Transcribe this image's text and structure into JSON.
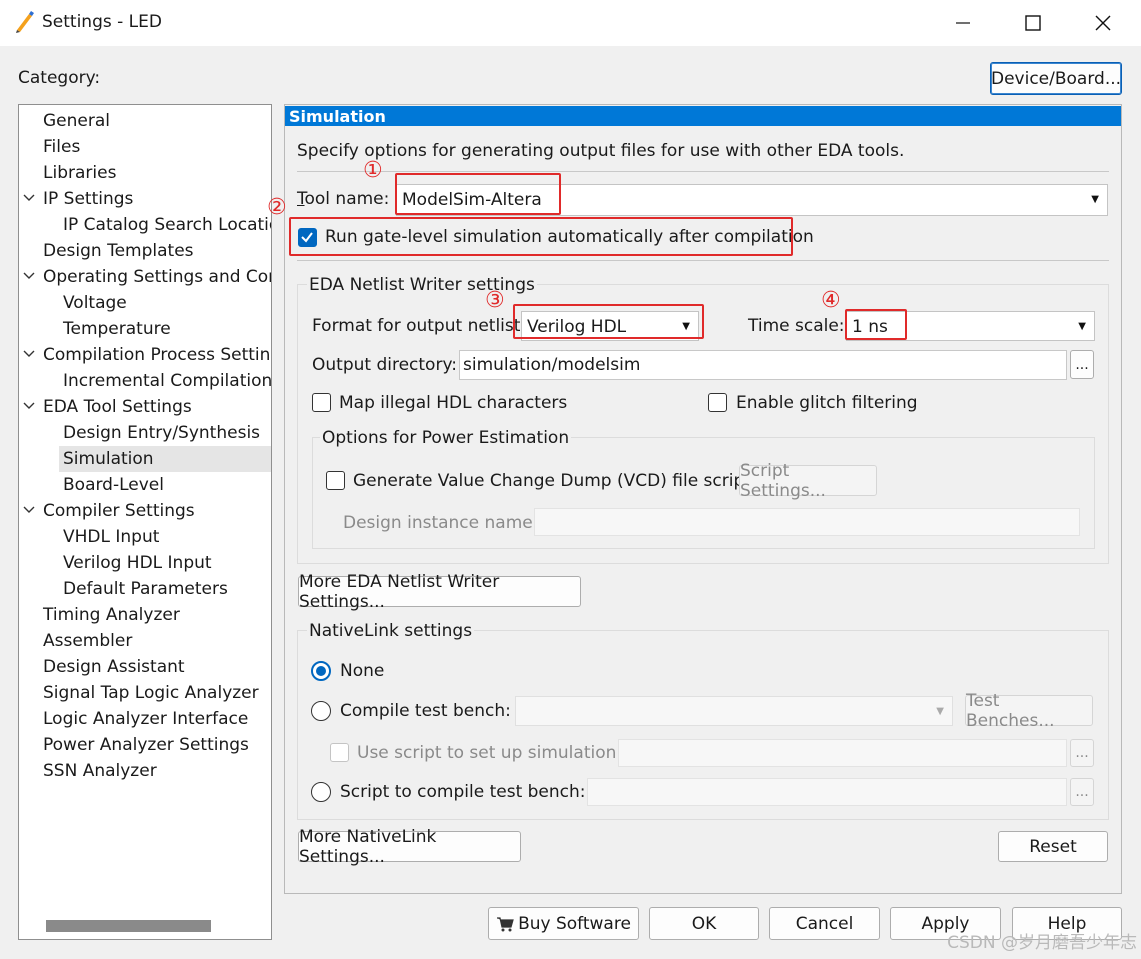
{
  "window": {
    "title": "Settings - LED",
    "icon": "quartus-pen-icon",
    "controls": [
      "minimize-icon",
      "maximize-icon",
      "close-icon"
    ]
  },
  "category_label": "Category:",
  "device_board_button": "Device/Board...",
  "tree": {
    "items": [
      {
        "label": "General",
        "level": 0
      },
      {
        "label": "Files",
        "level": 0
      },
      {
        "label": "Libraries",
        "level": 0
      },
      {
        "label": "IP Settings",
        "level": 0,
        "expanded": true
      },
      {
        "label": "IP Catalog Search Locatio",
        "level": 1
      },
      {
        "label": "Design Templates",
        "level": 0
      },
      {
        "label": "Operating Settings and Conc",
        "level": 0,
        "expanded": true
      },
      {
        "label": "Voltage",
        "level": 1
      },
      {
        "label": "Temperature",
        "level": 1
      },
      {
        "label": "Compilation Process Setting",
        "level": 0,
        "expanded": true
      },
      {
        "label": "Incremental Compilation",
        "level": 1
      },
      {
        "label": "EDA Tool Settings",
        "level": 0,
        "expanded": true
      },
      {
        "label": "Design Entry/Synthesis",
        "level": 1
      },
      {
        "label": "Simulation",
        "level": 1,
        "selected": true
      },
      {
        "label": "Board-Level",
        "level": 1
      },
      {
        "label": "Compiler Settings",
        "level": 0,
        "expanded": true
      },
      {
        "label": "VHDL Input",
        "level": 1
      },
      {
        "label": "Verilog HDL Input",
        "level": 1
      },
      {
        "label": "Default Parameters",
        "level": 1
      },
      {
        "label": "Timing Analyzer",
        "level": 0
      },
      {
        "label": "Assembler",
        "level": 0
      },
      {
        "label": "Design Assistant",
        "level": 0
      },
      {
        "label": "Signal Tap Logic Analyzer",
        "level": 0
      },
      {
        "label": "Logic Analyzer Interface",
        "level": 0
      },
      {
        "label": "Power Analyzer Settings",
        "level": 0
      },
      {
        "label": "SSN Analyzer",
        "level": 0
      }
    ]
  },
  "panel": {
    "header": "Simulation",
    "description": "Specify options for generating output files for use with other EDA tools.",
    "tool_name_label": "Tool name:",
    "tool_name_value": "ModelSim-Altera",
    "run_gate_level_label": "Run gate-level simulation automatically after compilation",
    "run_gate_level_checked": true,
    "netlist_group_title": "EDA Netlist Writer settings",
    "format_label": "Format for output netlist:",
    "format_value": "Verilog HDL",
    "time_scale_label": "Time scale:",
    "time_scale_value": "1 ns",
    "output_dir_label": "Output directory:",
    "output_dir_value": "simulation/modelsim",
    "browse_label": "...",
    "map_illegal_label": "Map illegal HDL characters",
    "map_illegal_checked": false,
    "glitch_label": "Enable glitch filtering",
    "glitch_checked": false,
    "power_group_title": "Options for Power Estimation",
    "vcd_label": "Generate Value Change Dump (VCD) file script",
    "vcd_checked": false,
    "script_settings_button": "Script Settings...",
    "design_instance_label": "Design instance name:",
    "design_instance_value": "",
    "more_netlist_button": "More EDA Netlist Writer Settings...",
    "nativelink_group_title": "NativeLink settings",
    "none_label": "None",
    "compile_tb_label": "Compile test bench:",
    "compile_tb_value": "",
    "test_benches_button": "Test Benches...",
    "use_script_label": "Use script to set up simulation:",
    "use_script_value": "",
    "script_compile_label": "Script to compile test bench:",
    "script_compile_value": "",
    "more_nativelink_button": "More NativeLink Settings...",
    "reset_button": "Reset",
    "nativelink_selected": "None"
  },
  "annotations": {
    "one": "①",
    "two": "②",
    "three": "③",
    "four": "④",
    "color": "#e02a2a"
  },
  "footer": {
    "buy_software": "Buy Software",
    "cart_icon": "cart-icon",
    "ok": "OK",
    "cancel": "Cancel",
    "apply": "Apply",
    "help": "Help"
  },
  "watermark": "CSDN @岁月磨吾少年志",
  "colors": {
    "accent": "#0078d7",
    "selected_tree_bg": "#e5e5e5"
  }
}
